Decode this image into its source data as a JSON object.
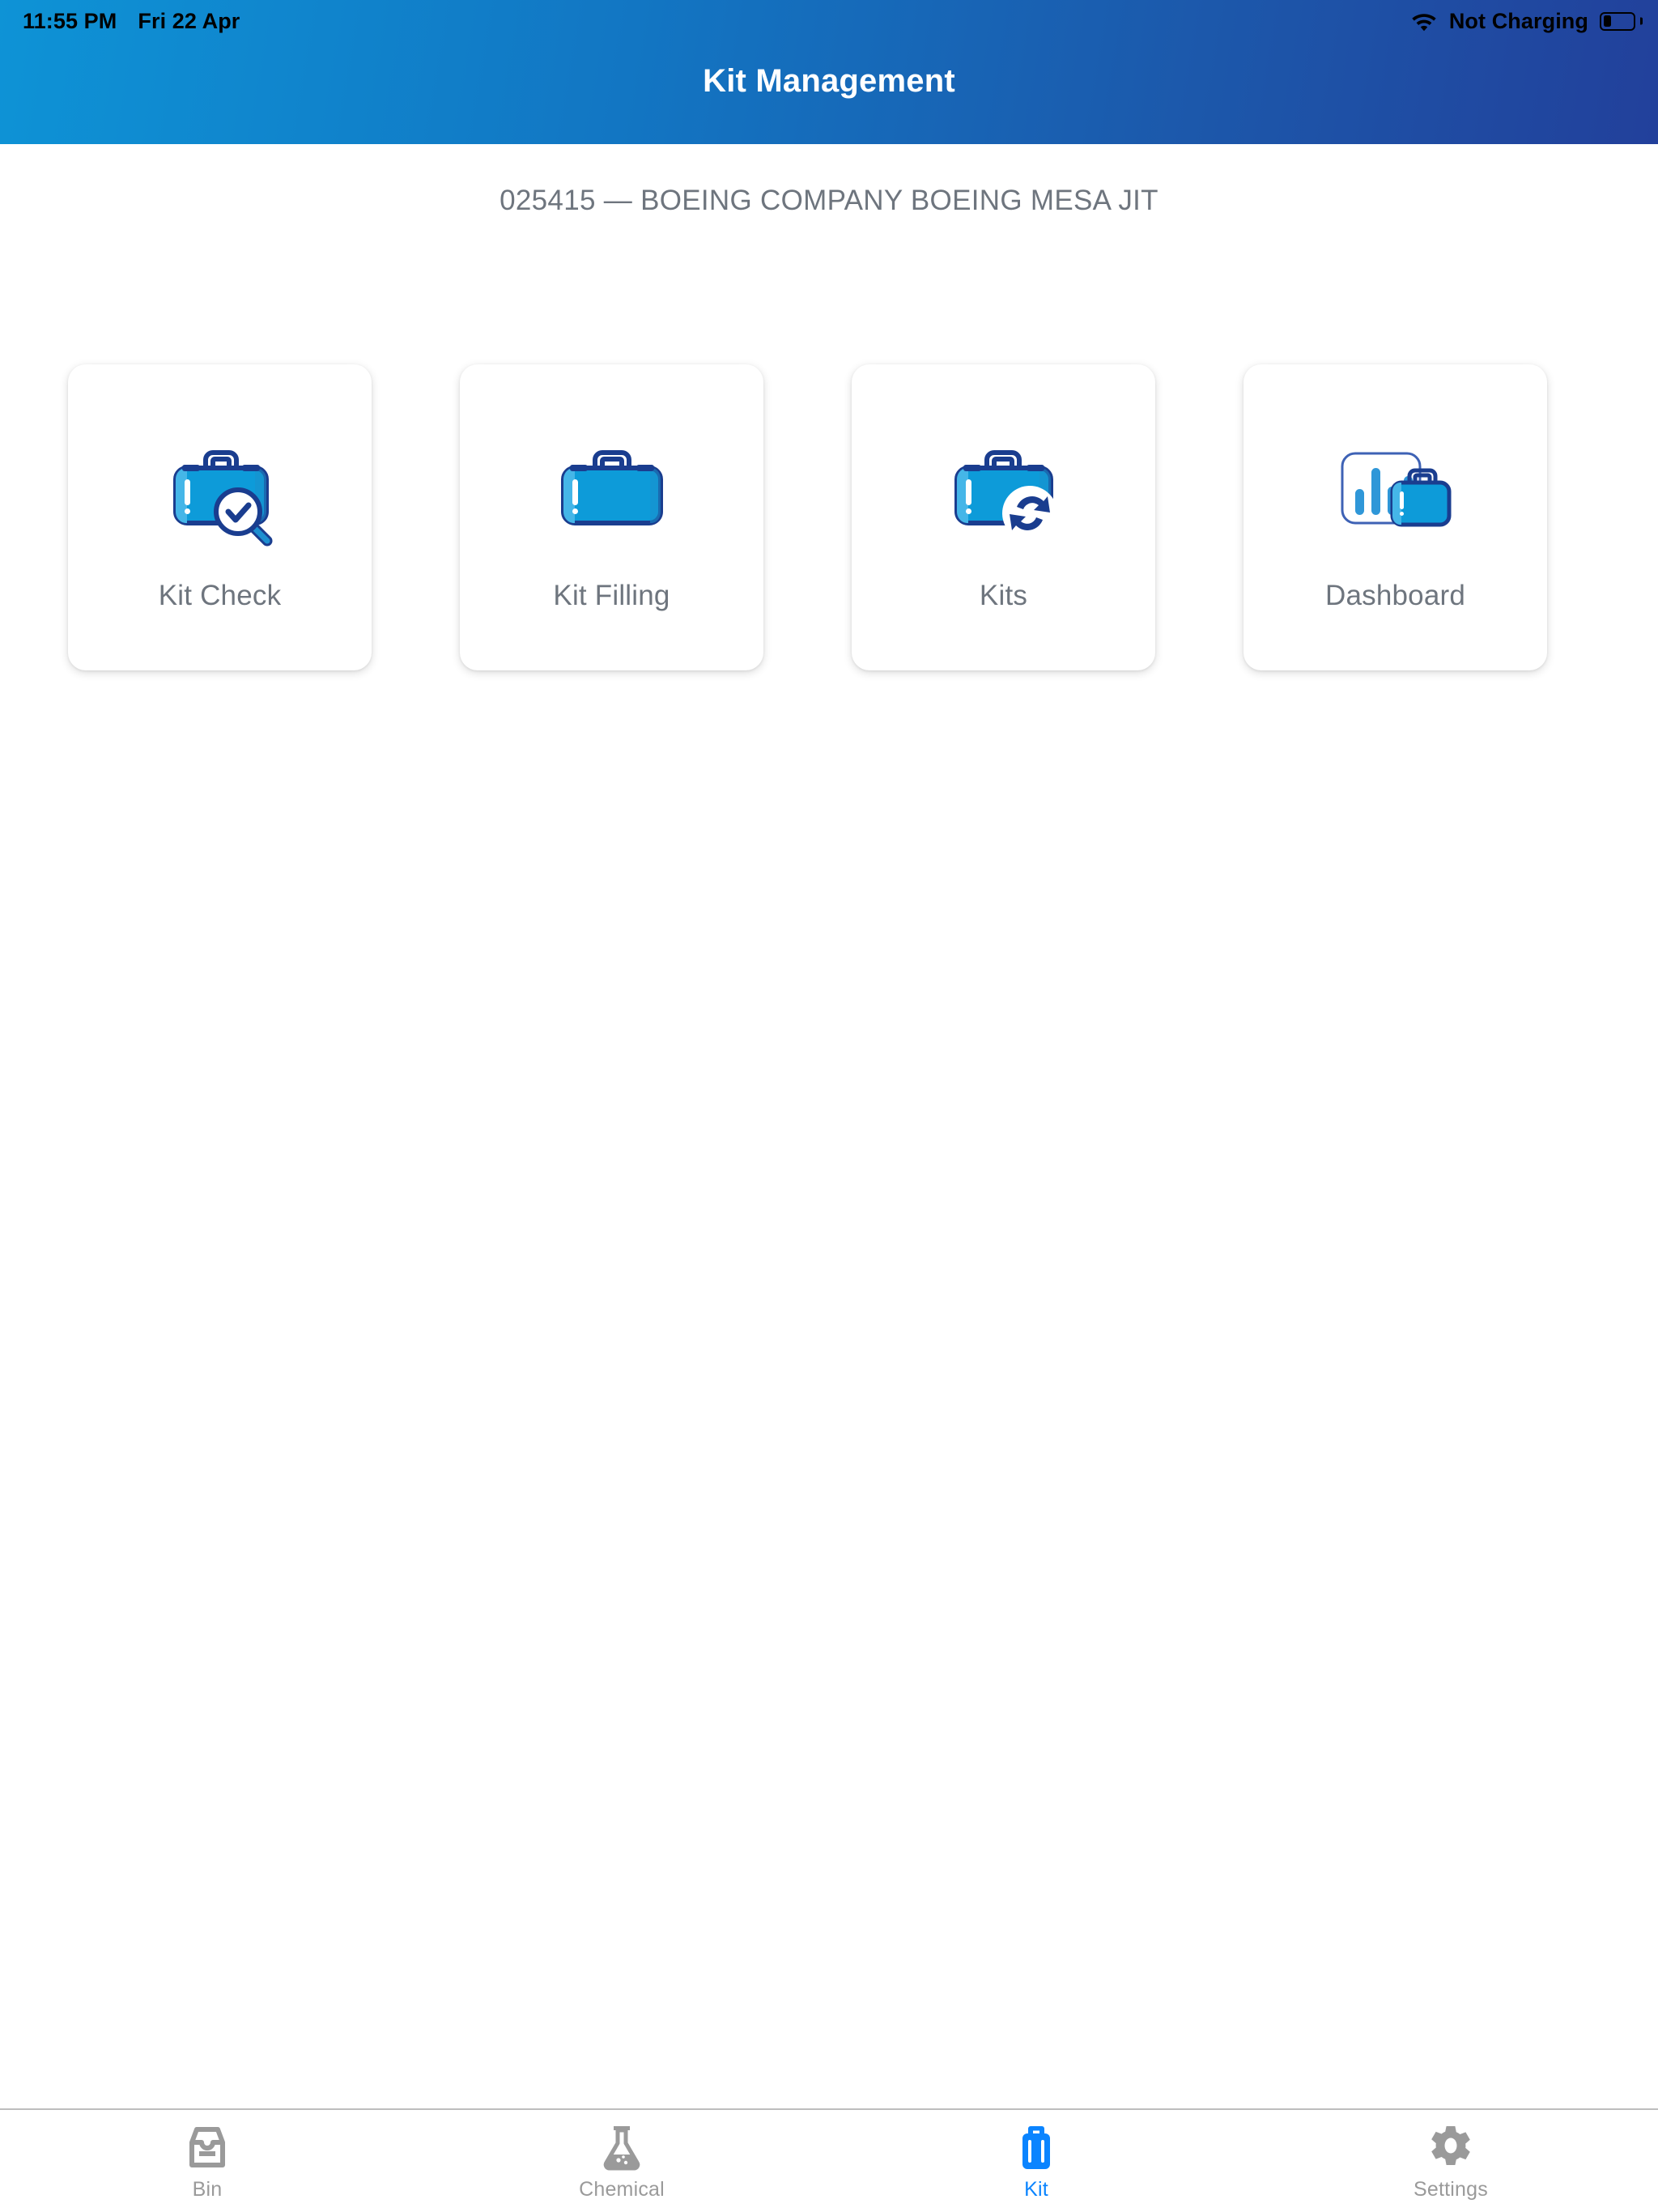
{
  "statusbar": {
    "time": "11:55 PM",
    "date": "Fri 22 Apr",
    "wifi_icon": "wifi-icon",
    "battery_status": "Not Charging",
    "battery_icon": "battery-low-icon",
    "battery_level_percent": 20,
    "text_color": "#000000"
  },
  "header": {
    "title": "Kit Management",
    "gradient_from": "#0E93D6",
    "gradient_to": "#22409B",
    "title_color": "#FFFFFF"
  },
  "subtitle": {
    "text": "025415 — BOEING COMPANY BOEING MESA JIT",
    "color": "#6E757E"
  },
  "cards": [
    {
      "label": "Kit Check",
      "icon": "briefcase-magnifier-check-icon"
    },
    {
      "label": "Kit Filling",
      "icon": "briefcase-icon"
    },
    {
      "label": "Kits",
      "icon": "briefcase-sync-icon"
    },
    {
      "label": "Dashboard",
      "icon": "barchart-briefcase-icon"
    }
  ],
  "card_style": {
    "background": "#FFFFFF",
    "label_color": "#6E757E",
    "icon_body_color": "#0D9BD9",
    "icon_outline_color": "#1A3D8F",
    "icon_highlight_color": "#45B6E8"
  },
  "tabbar": {
    "active_color": "#0A84FF",
    "inactive_color": "#9A9A9A",
    "items": [
      {
        "label": "Bin",
        "icon": "tray-icon",
        "active": false
      },
      {
        "label": "Chemical",
        "icon": "flask-icon",
        "active": false
      },
      {
        "label": "Kit",
        "icon": "suitcase-icon",
        "active": true
      },
      {
        "label": "Settings",
        "icon": "gear-icon",
        "active": false
      }
    ]
  }
}
